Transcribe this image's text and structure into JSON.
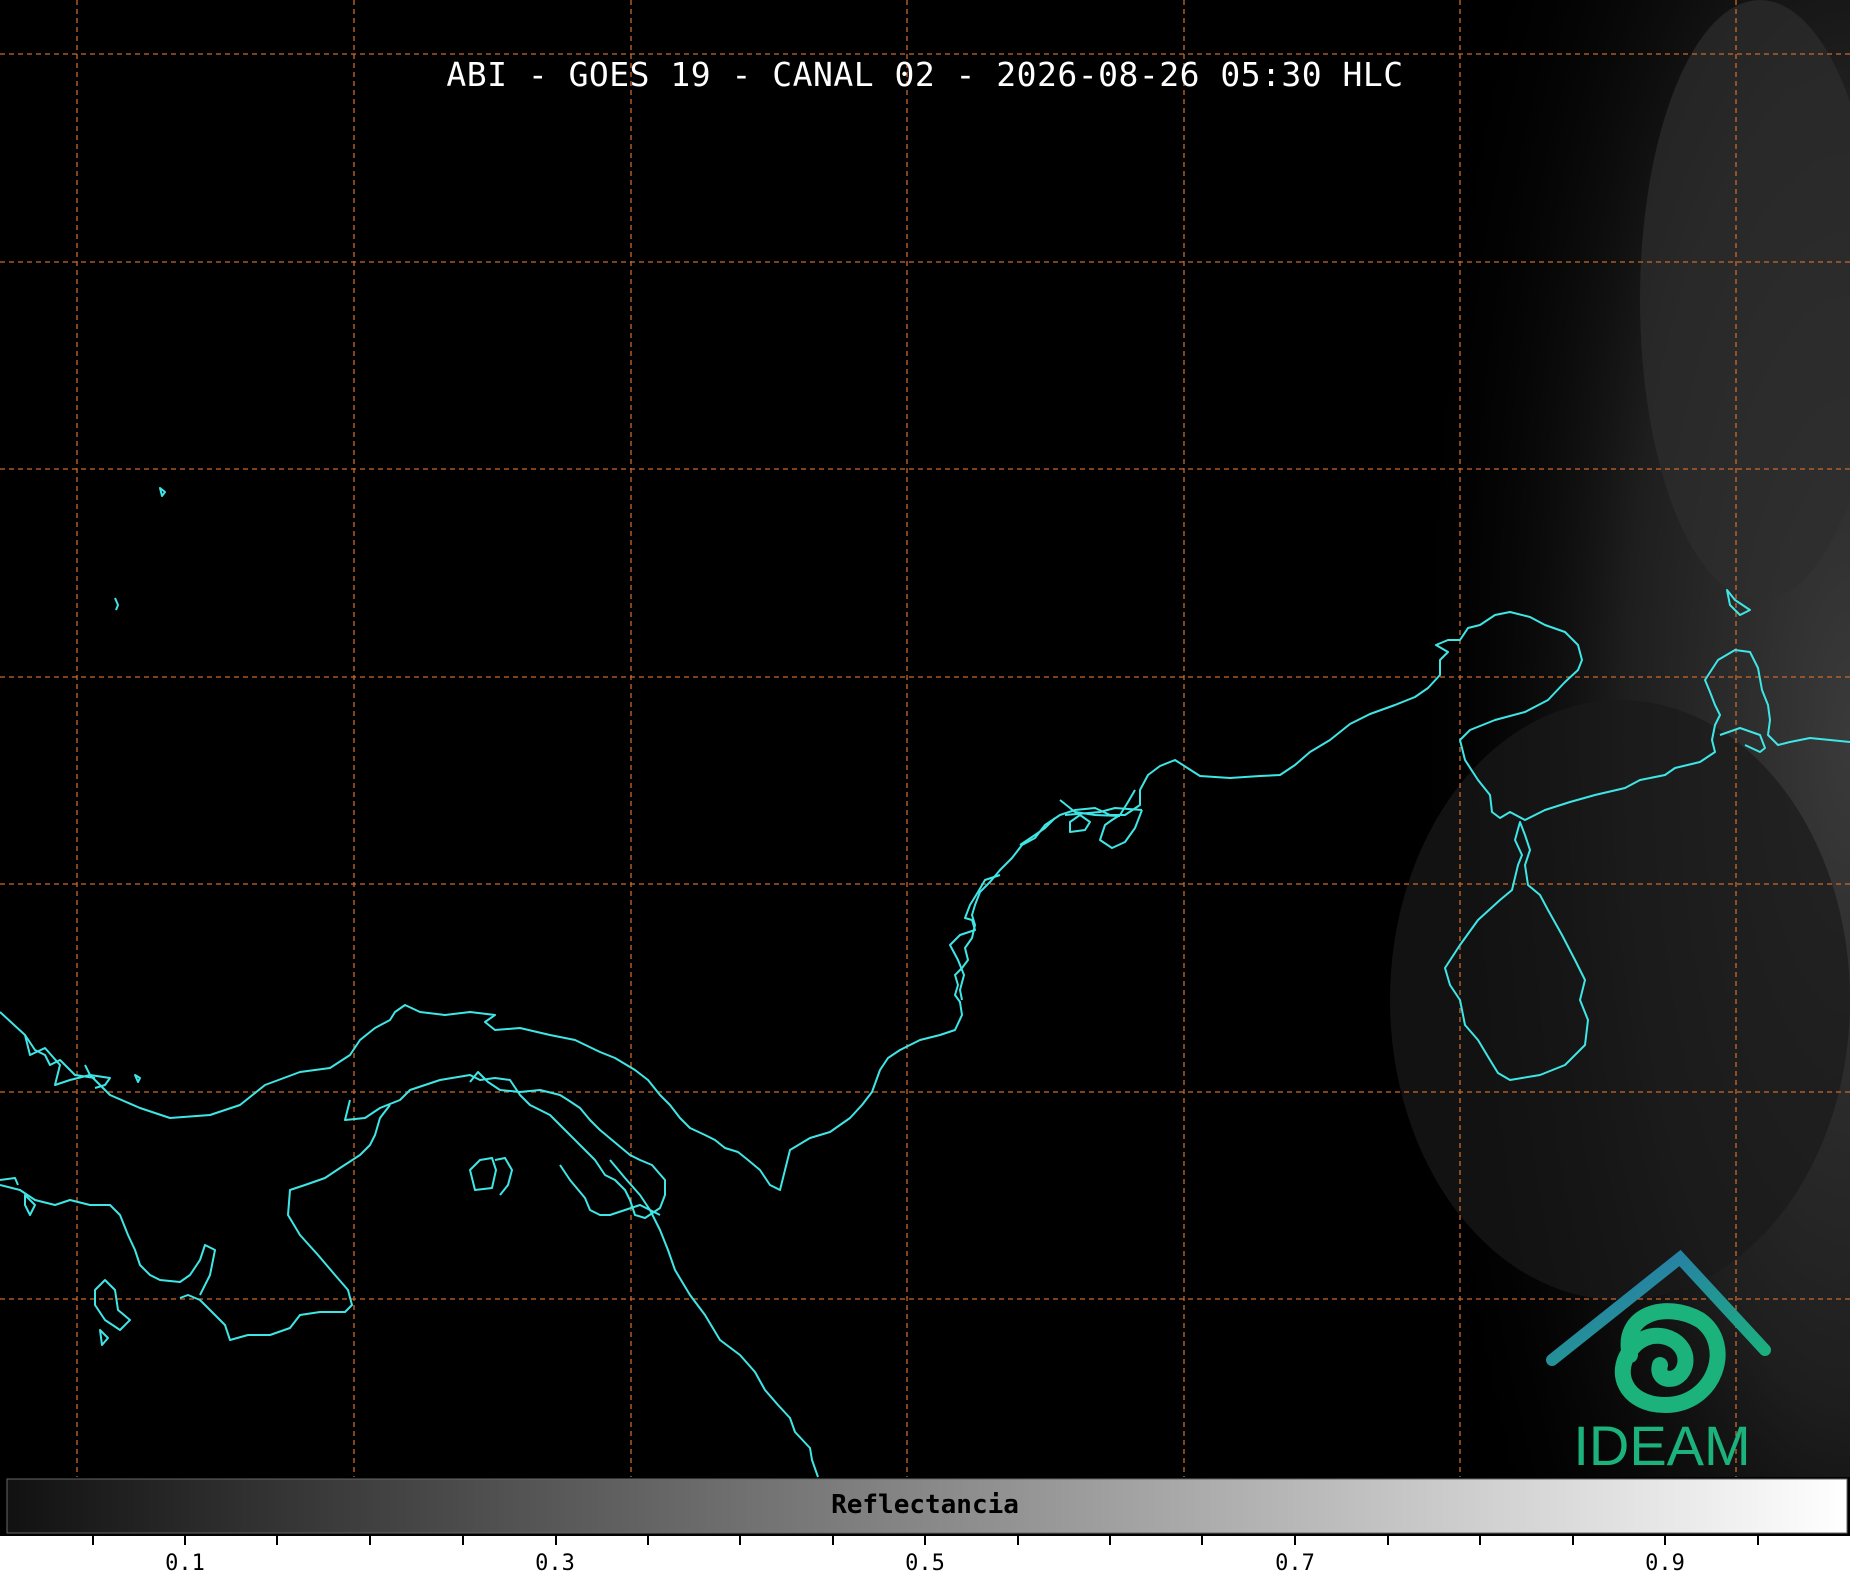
{
  "title": "ABI - GOES 19 - CANAL 02 - 2026-08-26 05:30 HLC",
  "colorbar": {
    "label": "Reflectancia",
    "ticks": [
      "0.1",
      "0.3",
      "0.5",
      "0.7",
      "0.9"
    ],
    "range": [
      0.0,
      1.0
    ],
    "gradient": [
      "#111111",
      "#ffffff"
    ]
  },
  "logo": {
    "text": "IDEAM"
  },
  "colors": {
    "coastline": "#3fe6e6",
    "grid": "#c86a2e",
    "logo_green": "#1bb27c",
    "logo_blue": "#2c6fb3"
  }
}
